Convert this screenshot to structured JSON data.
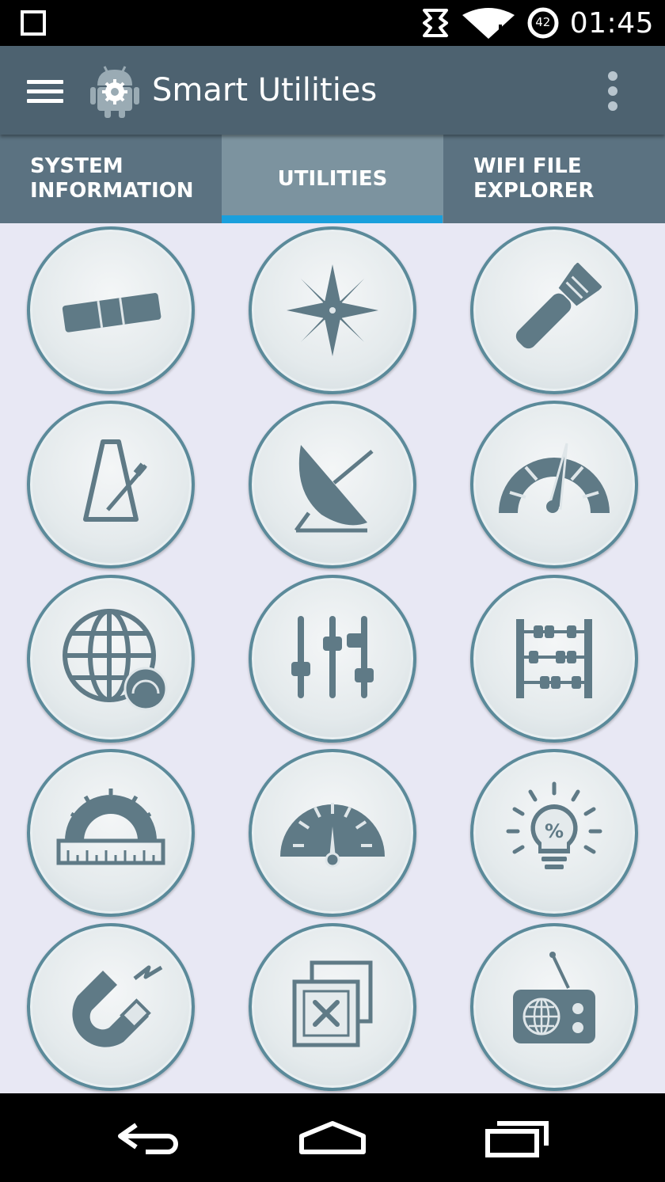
{
  "status_bar": {
    "time": "01:45",
    "battery_level": "42",
    "icons": [
      "notification-square-icon",
      "sync-icon",
      "wifi-icon",
      "battery-icon"
    ]
  },
  "app_bar": {
    "title": "Smart Utilities",
    "icons": [
      "menu-icon",
      "android-gear-logo",
      "overflow-menu-icon"
    ]
  },
  "tabs": [
    {
      "line1": "SYSTEM",
      "line2": "INFORMATION",
      "selected": false
    },
    {
      "line1": "UTILITIES",
      "line2": "",
      "selected": true
    },
    {
      "line1": "WIFI FILE",
      "line2": "EXPLORER",
      "selected": false
    }
  ],
  "colors": {
    "app_bar": "#4d6270",
    "tab_bar": "#5b7281",
    "tab_selected": "#7c939f",
    "tab_indicator": "#1a9fdc",
    "icon": "#5f7a86",
    "background": "#e8e8f4"
  },
  "tools": [
    {
      "icon": "spirit-level-icon"
    },
    {
      "icon": "compass-rose-icon"
    },
    {
      "icon": "flashlight-icon"
    },
    {
      "icon": "metronome-icon"
    },
    {
      "icon": "satellite-dish-icon"
    },
    {
      "icon": "speedometer-icon"
    },
    {
      "icon": "globe-speed-icon"
    },
    {
      "icon": "equalizer-icon"
    },
    {
      "icon": "abacus-icon"
    },
    {
      "icon": "protractor-ruler-icon"
    },
    {
      "icon": "gauge-icon"
    },
    {
      "icon": "lightbulb-percent-icon"
    },
    {
      "icon": "magnet-icon"
    },
    {
      "icon": "duplicate-files-delete-icon"
    },
    {
      "icon": "radio-icon"
    }
  ],
  "lightbulb_symbol": "%",
  "nav_bar": {
    "icons": [
      "back-icon",
      "home-icon",
      "recents-icon"
    ]
  }
}
